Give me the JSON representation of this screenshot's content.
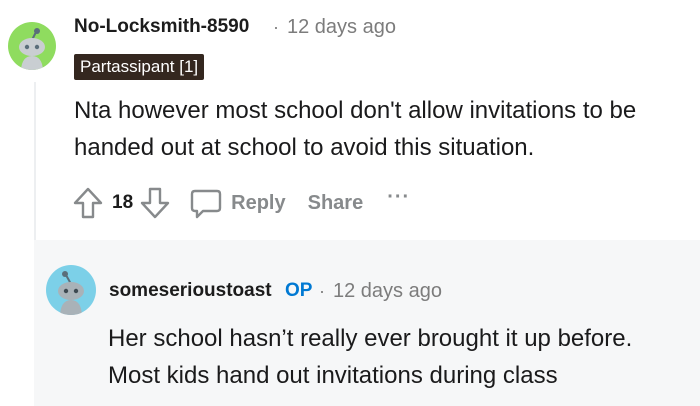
{
  "comment": {
    "username": "No-Locksmith-8590",
    "separator": "·",
    "timestamp": "12 days ago",
    "flair": "Partassipant [1]",
    "body_line1": "Nta however most school don't allow invitations to be",
    "body_line2": "handed out at school to avoid this situation.",
    "vote_count": "18",
    "reply_label": "Reply",
    "share_label": "Share",
    "more_label": "···",
    "avatar_color": "#8fdc5f"
  },
  "reply": {
    "username": "someserioustoast",
    "op_badge": "OP",
    "separator": "·",
    "timestamp": "12 days ago",
    "body_line1": "Her school hasn’t really ever brought it up before.",
    "body_line2": "Most kids hand out invitations during class",
    "avatar_color": "#7cd0e8"
  }
}
